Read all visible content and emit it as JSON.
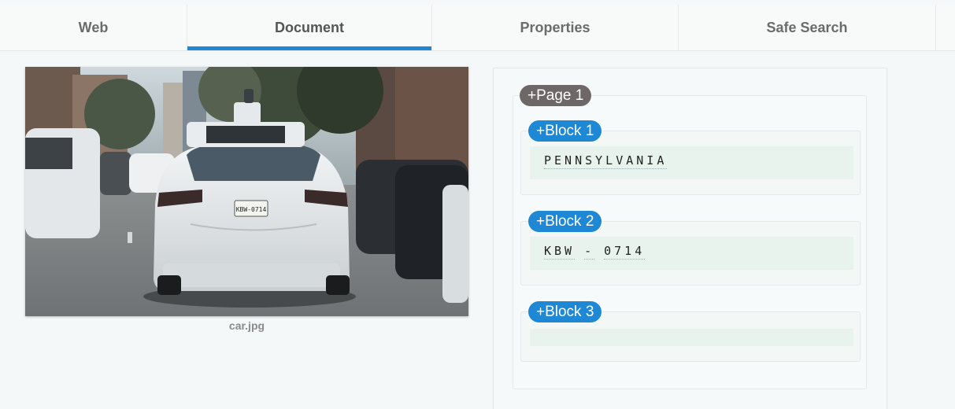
{
  "tabs": [
    {
      "label": "Web"
    },
    {
      "label": "Document"
    },
    {
      "label": "Properties"
    },
    {
      "label": "Safe Search"
    }
  ],
  "image": {
    "caption": "car.jpg",
    "plate_text": "KBW-0714"
  },
  "results": {
    "page_label": "+Page 1",
    "blocks": [
      {
        "label": "+Block 1",
        "words": [
          "PENNSYLVANIA"
        ]
      },
      {
        "label": "+Block 2",
        "words": [
          "KBW",
          "-",
          "0714"
        ]
      },
      {
        "label": "+Block 3",
        "words": []
      }
    ]
  },
  "colors": {
    "accent": "#1e88d4",
    "page_pill": "#6e6767",
    "block_fill": "#e7f3ec"
  }
}
